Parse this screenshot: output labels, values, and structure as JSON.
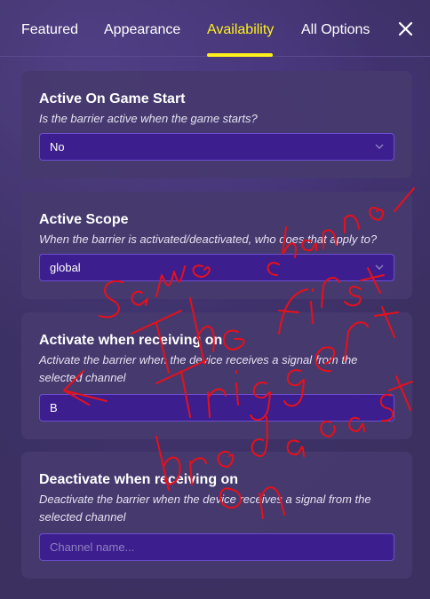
{
  "tabs": [
    {
      "label": "Featured"
    },
    {
      "label": "Appearance"
    },
    {
      "label": "Availability"
    },
    {
      "label": "All Options"
    }
  ],
  "active_tab_index": 2,
  "close_icon": "close-icon",
  "sections": [
    {
      "title": "Active On Game Start",
      "description": "Is the barrier active when the game starts?",
      "value": "No",
      "control": "dropdown"
    },
    {
      "title": "Active Scope",
      "description": "When the barrier is activated/deactivated, who does that apply to?",
      "value": "global",
      "control": "dropdown"
    },
    {
      "title": "Activate when receiving on",
      "description": "Activate the barrier when the device receives a signal from the selected channel",
      "value": "B",
      "control": "text"
    },
    {
      "title": "Deactivate when receiving on",
      "description": "Deactivate the barrier when the device receives a signal from the selected channel",
      "value": "",
      "placeholder": "Channel name...",
      "control": "text"
    }
  ],
  "colors": {
    "accent": "#fff11c",
    "field_bg": "#3c1e8e",
    "annotation": "#e8101a"
  }
}
